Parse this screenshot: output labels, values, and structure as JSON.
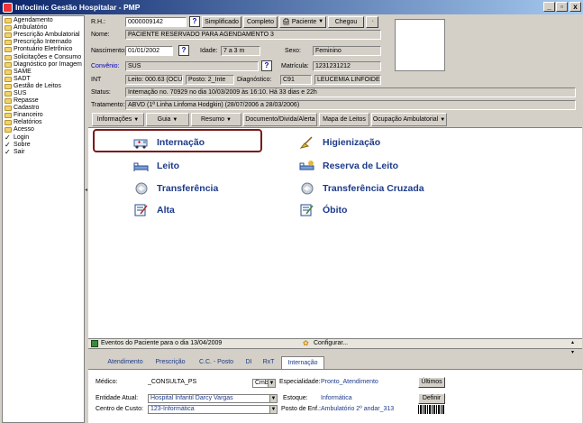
{
  "window": {
    "title": "Infoclinic Gestão Hospitalar - PMP",
    "min": "_",
    "max": "▫",
    "close": "x"
  },
  "sidebar": {
    "items": [
      {
        "label": "Agendamento",
        "icon": "folder-icon"
      },
      {
        "label": "Ambulatório",
        "icon": "folder-icon"
      },
      {
        "label": "Prescrição Ambulatorial",
        "icon": "folder-icon"
      },
      {
        "label": "Prescrição Internado",
        "icon": "folder-icon"
      },
      {
        "label": "Prontuário Eletrônico",
        "icon": "folder-icon"
      },
      {
        "label": "Solicitações e Consumo",
        "icon": "folder-icon"
      },
      {
        "label": "Diagnóstico por Imagem",
        "icon": "folder-icon"
      },
      {
        "label": "SAME",
        "icon": "folder-icon"
      },
      {
        "label": "SADT",
        "icon": "folder-icon"
      },
      {
        "label": "Gestão de Leitos",
        "icon": "folder-icon"
      },
      {
        "label": "SUS",
        "icon": "folder-icon"
      },
      {
        "label": "Repasse",
        "icon": "folder-icon"
      },
      {
        "label": "Cadastro",
        "icon": "folder-icon"
      },
      {
        "label": "Financeiro",
        "icon": "folder-icon"
      },
      {
        "label": "Relatórios",
        "icon": "folder-icon"
      },
      {
        "label": "Acesso",
        "icon": "folder-icon"
      },
      {
        "label": "Login",
        "icon": "check-icon"
      },
      {
        "label": "Sobre",
        "icon": "check-icon"
      },
      {
        "label": "Sair",
        "icon": "check-icon"
      }
    ]
  },
  "patient": {
    "rh_label": "R.H.:",
    "rh_value": "0000009142",
    "rh_help": "?",
    "simplificado": "Simplificado",
    "completo": "Completo",
    "paciente": "Paciente",
    "chegou": "Chegou",
    "nome_label": "Nome:",
    "nome_value": "PACIENTE RESERVADO PARA AGENDAMENTO 3",
    "nasc_label": "Nascimento:",
    "nasc_value": "01/01/2002",
    "nasc_help": "?",
    "idade_label": "Idade:",
    "idade_value": "7 a 3 m",
    "sexo_label": "Sexo:",
    "sexo_value": "Feminino",
    "conv_label": "Convênio:",
    "conv_value": "SUS",
    "conv_help": "?",
    "matr_label": "Matrícula:",
    "matr_value": "1231231212",
    "int_label": "INT",
    "int_value": "Leito: 000.63 (OCU)",
    "posto_value": "Posto: 2_Inte",
    "diag_label": "Diagnóstico:",
    "diag_code": "C91",
    "diag_desc": "LEUCEMIA LINFOIDE",
    "status_label": "Status:",
    "status_value": "Internação no. 70929 no dia 10/03/2009  às  16:10. Há 33 dias e 22h",
    "trat_label": "Tratamento:",
    "trat_value": "ABVD (1ª Linha Linfoma Hodgkin) (28/07/2006 a 28/03/2006)"
  },
  "menu": {
    "items": [
      "Informações",
      "Guia",
      "Resumo",
      "Documento/Divida/Alerta",
      "Mapa de Leitos",
      "Ocupação Ambulatorial"
    ]
  },
  "actions": {
    "internacao": "Internação",
    "higienizacao": "Higienização",
    "leito": "Leito",
    "reserva": "Reserva de Leito",
    "transferencia": "Transferência",
    "transf_cruzada": "Transferência Cruzada",
    "alta": "Alta",
    "obito": "Óbito"
  },
  "events": {
    "text": "Eventos do Paciente para o dia 13/04/2009",
    "config": "Configurar..."
  },
  "bottom_tabs": [
    "Atendimento",
    "Prescrição",
    "C.C. - Posto",
    "DI",
    "RxT",
    "Internação"
  ],
  "bottom": {
    "medico_label": "Médico:",
    "medico_value": "_CONSULTA_PS",
    "cmb_value": "Cmb_",
    "esp_label": "Especialidade:",
    "esp_value": "Pronto_Atendimento",
    "ultimos": "Últimos",
    "entidade_label": "Entidade Atual:",
    "entidade_value": "Hospital Infantil Darcy Vargas",
    "estoque_label": "Estoque:",
    "estoque_value": "Informática",
    "definir": "Definir",
    "cc_label": "Centro de Custo:",
    "cc_value": "123-Informática",
    "posto_label": "Posto de Enf.:",
    "posto_value": "Ambulatório 2º andar_313"
  }
}
